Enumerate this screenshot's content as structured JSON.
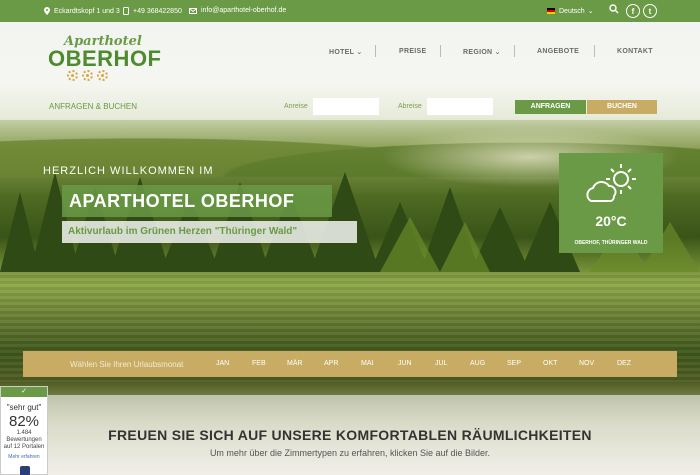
{
  "topbar": {
    "address": "Eckardtskopf 1 und 3",
    "phone": "+49 368422850",
    "email": "info@aparthotel-oberhof.de",
    "language": "Deutsch",
    "facebook": "f",
    "twitter": "t"
  },
  "logo": {
    "script": "Aparthotel",
    "main": "OBERHOF"
  },
  "nav": {
    "hotel": "HOTEL",
    "preise": "PREISE",
    "region": "REGION",
    "angebote": "ANGEBOTE",
    "kontakt": "KONTAKT"
  },
  "booking": {
    "label": "ANFRAGEN & BUCHEN",
    "arrival_label": "Anreise",
    "departure_label": "Abreise",
    "arrival_value": "",
    "departure_value": "",
    "inquire": "ANFRAGEN",
    "book": "BUCHEN"
  },
  "hero": {
    "welcome": "HERZLICH WILLKOMMEN IM",
    "title": "APARTHOTEL OBERHOF",
    "subtitle": "Aktivurlaub im Grünen Herzen \"Thüringer Wald\""
  },
  "weather": {
    "temperature": "20°C",
    "location": "OBERHOF, THÜRINGER WALD",
    "icon": "partly-sunny-icon"
  },
  "months": {
    "prompt": "Wählen Sie Ihren Urlaubsmonat",
    "items": [
      "JAN",
      "FEB",
      "MÄR",
      "APR",
      "MAI",
      "JUN",
      "JUL",
      "AUG",
      "SEP",
      "OKT",
      "NOV",
      "DEZ"
    ]
  },
  "content": {
    "heading": "FREUEN SIE SICH AUF UNSERE KOMFORTABLEN RÄUMLICHKEITEN",
    "lead": "Um mehr über die Zimmertypen zu erfahren, klicken Sie auf die Bilder."
  },
  "rating": {
    "check": "✓",
    "quality": "\"sehr gut\"",
    "percent": "82%",
    "count": "1.484",
    "reviews": "Bewertungen",
    "portals": "auf 12 Portalen",
    "more": "Mehr erfahren"
  },
  "colors": {
    "green": "#6a9a45",
    "gold": "#c9ac64"
  }
}
